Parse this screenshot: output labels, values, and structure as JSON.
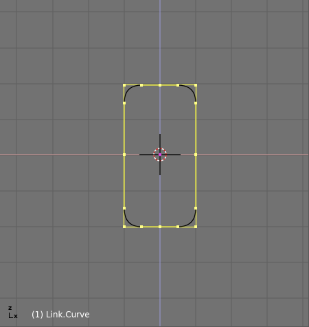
{
  "viewport": {
    "background_color": "#727272",
    "grid_color": "#5f5f5f",
    "x_axis_color": "#d9a0a0",
    "y_axis_color": "#9a9ad8",
    "object_label": "(1) Link.Curve",
    "axis_z_label": "z",
    "axis_x_label": "x"
  },
  "curve": {
    "selected_color": "#ffff55",
    "curve_color": "#000000",
    "vertex_color": "#ffff88"
  },
  "cursor_3d": {
    "ring_color_a": "#cc2222",
    "ring_color_b": "#ffffff",
    "crosshair_color": "#000000"
  }
}
